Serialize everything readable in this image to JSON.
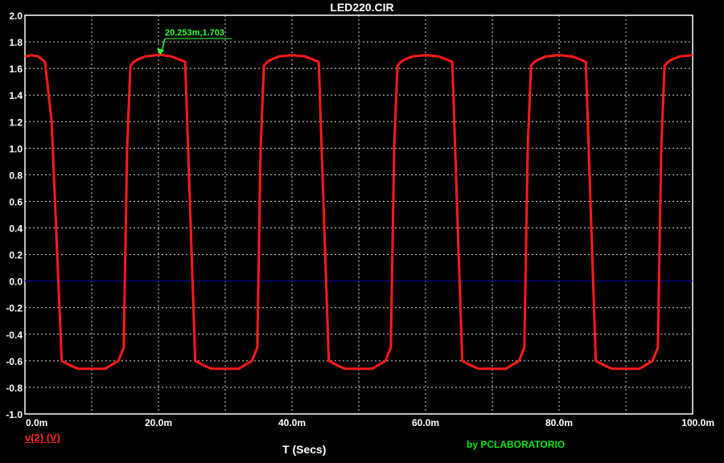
{
  "chart_data": {
    "type": "line",
    "title": "LED220.CIR",
    "xlabel": "T (Secs)",
    "ylabel": "",
    "xlim": [
      0,
      100
    ],
    "ylim": [
      -1.0,
      2.0
    ],
    "x_ticks": [
      "0.0m",
      "20.0m",
      "40.0m",
      "60.0m",
      "80.0m",
      "100.0m"
    ],
    "x_tick_values": [
      0,
      20,
      40,
      60,
      80,
      100
    ],
    "y_ticks": [
      "2.0",
      "1.8",
      "1.6",
      "1.4",
      "1.2",
      "1.0",
      "0.8",
      "0.6",
      "0.4",
      "0.2",
      "0.0",
      "-0.2",
      "-0.4",
      "-0.6",
      "-0.8",
      "-1.0"
    ],
    "y_tick_values": [
      2.0,
      1.8,
      1.6,
      1.4,
      1.2,
      1.0,
      0.8,
      0.6,
      0.4,
      0.2,
      0.0,
      -0.2,
      -0.4,
      -0.6,
      -0.8,
      -1.0
    ],
    "grid": true,
    "series": [
      {
        "name": "v(2) (V)",
        "color": "#ff1a1a",
        "x": [
          0,
          1,
          2,
          3,
          4,
          5.5,
          7,
          8,
          12,
          14,
          14.8,
          15.3,
          15.8,
          16.3,
          17,
          18,
          20.253,
          22,
          24,
          25.5,
          27,
          28,
          32,
          34,
          34.8,
          35.3,
          35.8,
          36.3,
          37,
          38,
          40,
          42,
          44,
          45.5,
          47,
          48,
          52,
          54,
          54.8,
          55.3,
          55.8,
          56.3,
          57,
          58,
          60,
          62,
          64,
          65.5,
          67,
          68,
          72,
          74,
          74.8,
          75.3,
          75.8,
          76.3,
          77,
          78,
          80,
          82,
          84,
          85.5,
          87,
          88,
          92,
          94,
          94.8,
          95.3,
          95.8,
          96.3,
          97,
          98,
          100
        ],
        "y": [
          1.69,
          1.7,
          1.69,
          1.65,
          1.2,
          -0.6,
          -0.64,
          -0.66,
          -0.66,
          -0.6,
          -0.5,
          1.0,
          1.62,
          1.65,
          1.67,
          1.69,
          1.703,
          1.69,
          1.65,
          -0.6,
          -0.64,
          -0.66,
          -0.66,
          -0.6,
          -0.5,
          1.0,
          1.62,
          1.65,
          1.67,
          1.69,
          1.7,
          1.69,
          1.65,
          -0.6,
          -0.64,
          -0.66,
          -0.66,
          -0.6,
          -0.5,
          1.0,
          1.62,
          1.65,
          1.67,
          1.69,
          1.7,
          1.69,
          1.65,
          -0.6,
          -0.64,
          -0.66,
          -0.66,
          -0.6,
          -0.5,
          1.0,
          1.62,
          1.65,
          1.67,
          1.69,
          1.7,
          1.69,
          1.65,
          -0.6,
          -0.64,
          -0.66,
          -0.66,
          -0.6,
          -0.5,
          1.0,
          1.62,
          1.65,
          1.67,
          1.69,
          1.7
        ]
      }
    ],
    "annotations": [
      {
        "text": "20.253m,1.703",
        "x": 20.253,
        "y": 1.703,
        "color": "#30ff30"
      }
    ],
    "zero_line_color": "#00007f"
  },
  "labels": {
    "legend": "v(2) (V)",
    "credit": "by PCLABORATORIO",
    "cursor": "20.253m,1.703"
  }
}
